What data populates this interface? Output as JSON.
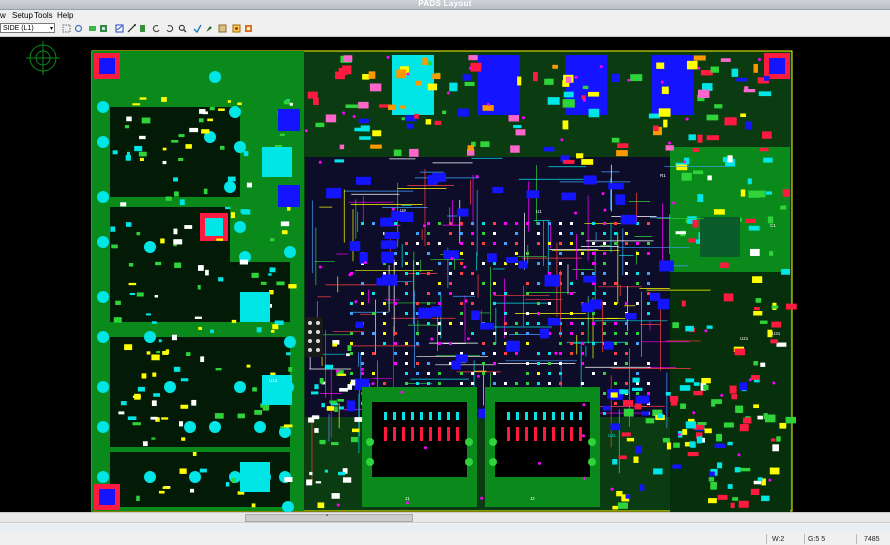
{
  "window": {
    "title": "PADS Layout"
  },
  "menu": {
    "view": "w",
    "setup": "Setup",
    "tools": "Tools",
    "help": "Help"
  },
  "toolbar": {
    "layer": "SIDE (L1)",
    "layer_arrow": "▾"
  },
  "status": {
    "width": "W:2",
    "grid": "G:5 5",
    "coord": "7485"
  },
  "board": {
    "colors": {
      "background": "#000000",
      "copper": "#0a8a1a",
      "copper_light": "#2fd43a",
      "pad": "#00e5e5",
      "component": "#1414ff",
      "outline": "#ffff00",
      "keepout": "#ff1a40",
      "via": "#ff00ff"
    },
    "labels": {
      "u1": "U1",
      "j1": "J1",
      "j2": "J2",
      "u21": "U21",
      "u31": "U31",
      "u11": "U11",
      "c1": "C1",
      "r1": "R1",
      "u9": "U9",
      "u12": "U12"
    }
  }
}
